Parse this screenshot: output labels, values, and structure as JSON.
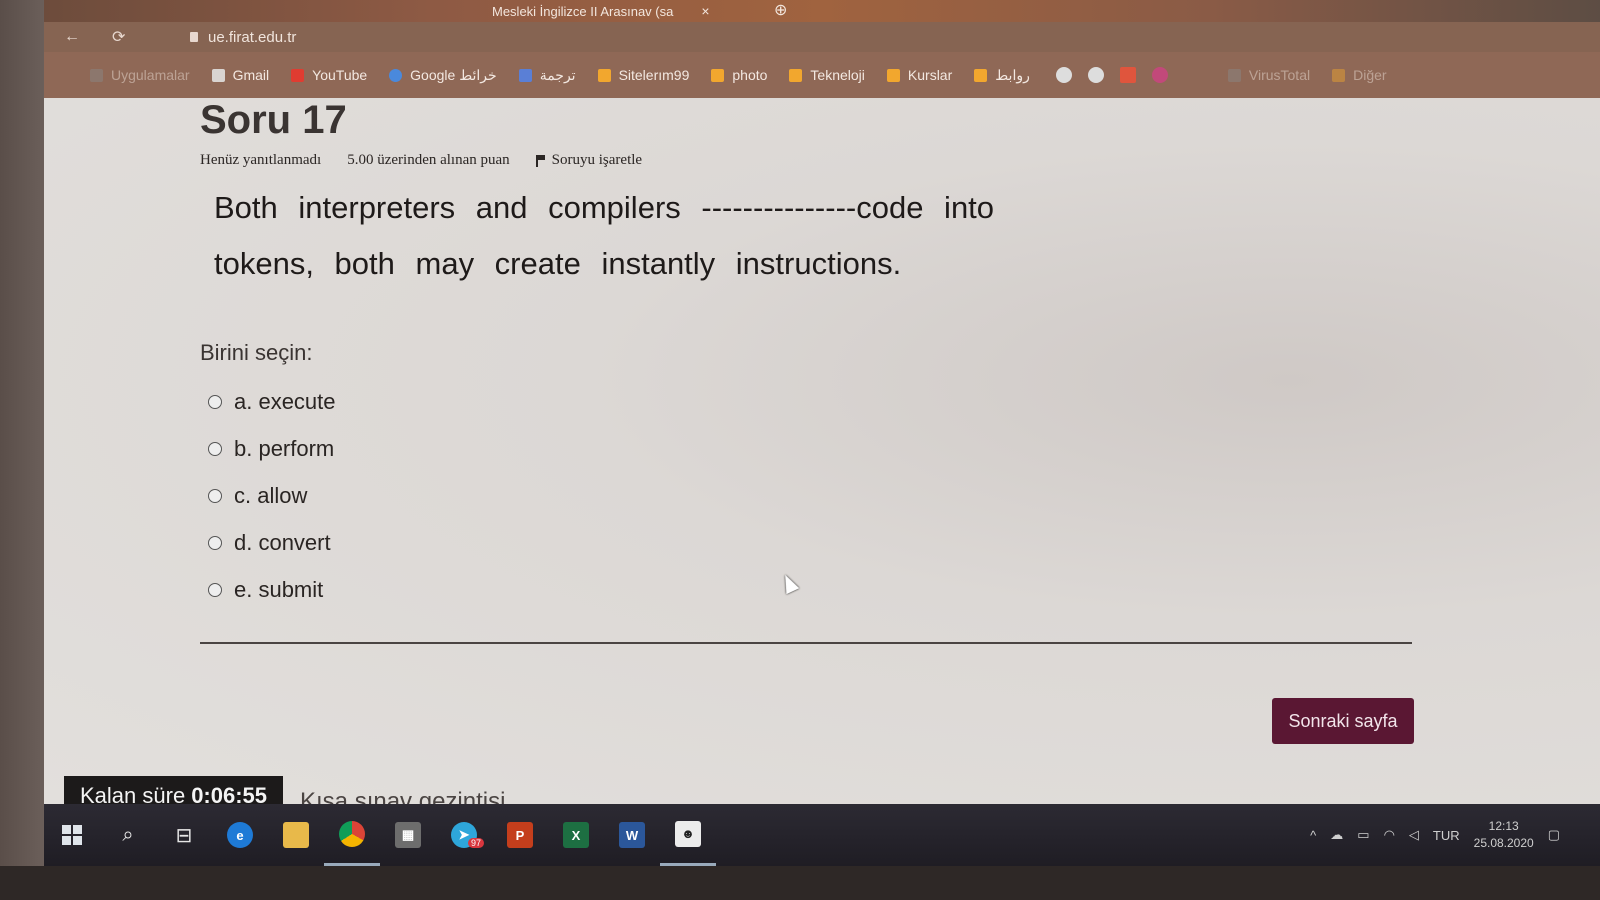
{
  "browser": {
    "tab_title": "Mesleki İngilizce II Arasınav (sa",
    "tab_close": "×",
    "url": "ue.firat.edu.tr",
    "bookmarks": [
      {
        "label": "Uygulamalar",
        "color": "#8a8a8a",
        "faded": true
      },
      {
        "label": "Gmail",
        "color": "#d9d4d1"
      },
      {
        "label": "YouTube",
        "color": "#e03c31"
      },
      {
        "label": "Google خرائط",
        "color": "#4a89dc"
      },
      {
        "label": "ترجمة",
        "color": "#5a7fd6"
      },
      {
        "label": "Sitelerım99",
        "color": "#f2a72e"
      },
      {
        "label": "photo",
        "color": "#f2a72e"
      },
      {
        "label": "Tekneloji",
        "color": "#f2a72e"
      },
      {
        "label": "Kurslar",
        "color": "#f2a72e"
      },
      {
        "label": "روابط",
        "color": "#f2a72e"
      }
    ],
    "bookmarks_trailing": [
      {
        "label": "VirusTotal",
        "color": "#8a8a8a"
      },
      {
        "label": "Diğer",
        "color": "#f2a72e"
      }
    ]
  },
  "question": {
    "title": "Soru 17",
    "status": "Henüz yanıtlanmadı",
    "points": "5.00 üzerinden alınan puan",
    "flag_label": "Soruyu işaretle",
    "text_line1": "Both interpreters and compilers ---------------code into",
    "text_line2": "tokens, both may create instantly instructions.",
    "choose_label": "Birini seçin:",
    "answers": [
      {
        "label": "a. execute"
      },
      {
        "label": "b. perform"
      },
      {
        "label": "c. allow"
      },
      {
        "label": "d. convert"
      },
      {
        "label": "e. submit"
      }
    ]
  },
  "actions": {
    "next_page": "Sonraki sayfa"
  },
  "timer": {
    "label": "Kalan süre",
    "value": "0:06:55"
  },
  "quiz_navigation": "Kısa sınav gezintisi",
  "taskbar": {
    "apps": [
      "Start",
      "Search",
      "Task View",
      "Edge",
      "File Explorer",
      "Chrome",
      "Store",
      "Telegram",
      "PowerPoint",
      "Excel",
      "Word",
      "Person"
    ],
    "telegram_badge": "97",
    "language": "TUR",
    "time": "12:13",
    "date": "25.08.2020"
  },
  "colors": {
    "next_button": "#5a1733",
    "timer_bg": "#1c1a1a",
    "taskbar_bg": "#1f1d24"
  }
}
